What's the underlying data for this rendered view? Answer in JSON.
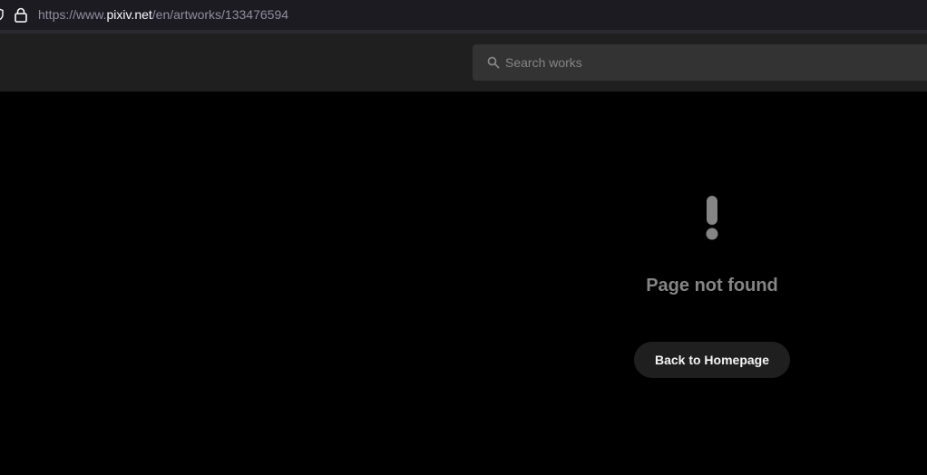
{
  "browser": {
    "url_prefix": "https://www.",
    "url_domain": "pixiv.net",
    "url_path": "/en/artworks/133476594",
    "icons": [
      "tracking-shield-icon",
      "lock-icon"
    ]
  },
  "header": {
    "search": {
      "placeholder": "Search works",
      "value": "",
      "icon": "search-icon"
    }
  },
  "error": {
    "icon": "exclamation-icon",
    "title": "Page not found",
    "button_label": "Back to Homepage"
  },
  "colors": {
    "page_background": "#000000",
    "header_background": "#1f1f1f",
    "search_background": "#333333",
    "muted_text": "#858585",
    "button_text": "#f5f5f5"
  }
}
